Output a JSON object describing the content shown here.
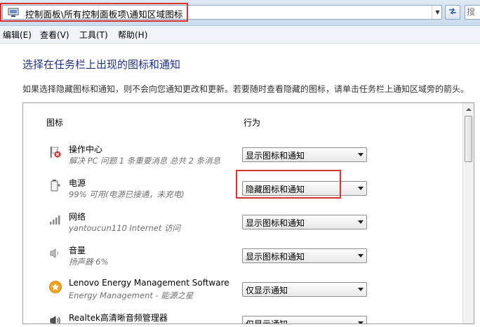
{
  "address": {
    "path": "控制面板\\所有控制面板项\\通知区域图标",
    "search_placeholder": "搜"
  },
  "menu": {
    "items": [
      {
        "label": "编辑(E)"
      },
      {
        "label": "查看(V)"
      },
      {
        "label": "工具(T)"
      },
      {
        "label": "帮助(H)"
      }
    ]
  },
  "page": {
    "title": "选择在任务栏上出现的图标和通知",
    "description": "如果选择隐藏图标和通知，则不会向您通知更改和更新。若要随时查看隐藏的图标，请单击任务栏上通知区域旁的箭头。"
  },
  "table": {
    "col_icon": "图标",
    "col_behavior": "行为",
    "rows": [
      {
        "icon": "action-center-flag-icon",
        "name": "操作中心",
        "detail": "解决 PC 问题  1 条重要消息  总共 2 条消息",
        "behavior": "显示图标和通知"
      },
      {
        "icon": "power-plug-icon",
        "name": "电源",
        "detail": "99% 可用(电源已接通，未充电)",
        "behavior": "隐藏图标和通知"
      },
      {
        "icon": "network-signal-icon",
        "name": "网络",
        "detail": "yantoucun110 Internet 访问",
        "behavior": "显示图标和通知"
      },
      {
        "icon": "speaker-volume-icon",
        "name": "音量",
        "detail": "扬声器 6%",
        "behavior": "显示图标和通知"
      },
      {
        "icon": "lenovo-star-icon",
        "name": "Lenovo Energy Management Software",
        "detail": "Energy Management - 能源之星",
        "behavior": "仅显示通知"
      },
      {
        "icon": "realtek-speaker-icon",
        "name": "Realtek高清晰音频管理器",
        "detail": "",
        "behavior": "仅显示通知"
      }
    ]
  },
  "colors": {
    "title": "#1e3287",
    "highlight": "#d7332f"
  }
}
